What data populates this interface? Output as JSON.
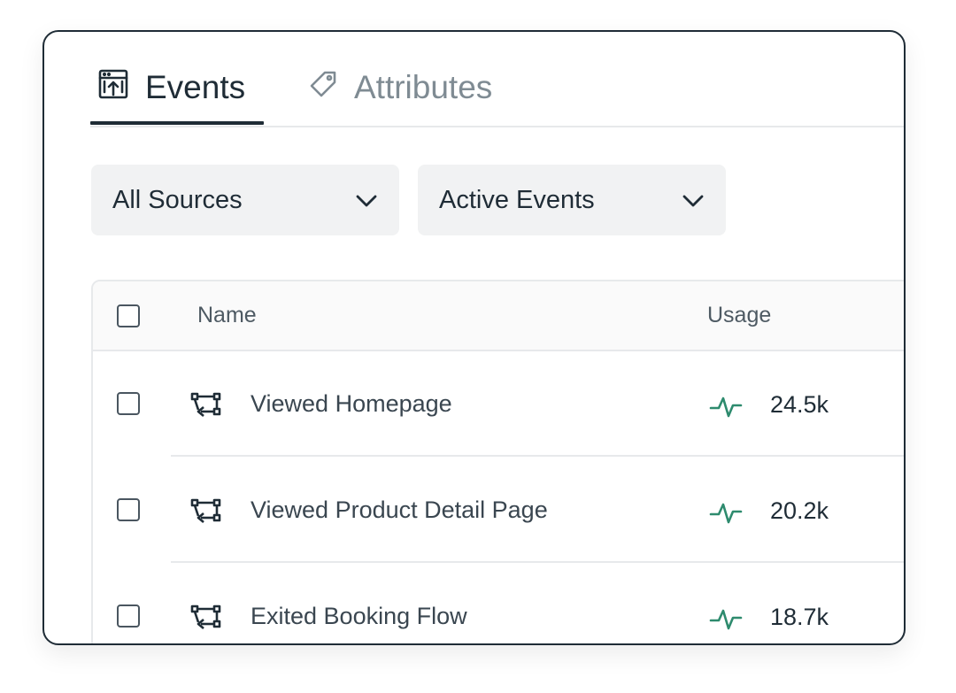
{
  "tabs": [
    {
      "label": "Events",
      "icon": "browser-upload-icon",
      "active": true
    },
    {
      "label": "Attributes",
      "icon": "tag-icon",
      "active": false
    }
  ],
  "filters": {
    "sources": {
      "label": "All Sources",
      "icon": "chevron-down-icon"
    },
    "status": {
      "label": "Active Events",
      "icon": "chevron-down-icon"
    }
  },
  "table": {
    "headers": {
      "name": "Name",
      "usage": "Usage"
    },
    "rows": [
      {
        "name": "Viewed Homepage",
        "usage": "24.5k"
      },
      {
        "name": "Viewed Product Detail Page",
        "usage": "20.2k"
      },
      {
        "name": "Exited Booking Flow",
        "usage": "18.7k"
      }
    ]
  },
  "colors": {
    "text_primary": "#1f2c36",
    "text_muted": "#7f8b93",
    "accent_green": "#2e8b6e",
    "filter_bg": "#f1f2f3",
    "border": "#e7e9eb"
  }
}
